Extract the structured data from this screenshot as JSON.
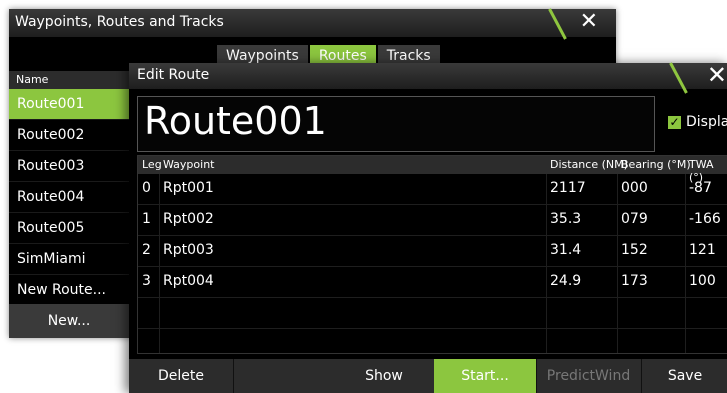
{
  "back_window": {
    "title": "Waypoints, Routes and Tracks",
    "tabs": [
      "Waypoints",
      "Routes",
      "Tracks"
    ],
    "list_header": "Name",
    "items": [
      "Route001",
      "Route002",
      "Route003",
      "Route004",
      "Route005",
      "SimMiami",
      "New Route..."
    ],
    "footer_button": "New...",
    "accent": "#8cc63f"
  },
  "front_window": {
    "title": "Edit Route",
    "route_name": "Route001",
    "display_label": "Display",
    "columns": {
      "leg": "Leg",
      "waypoint": "Waypoint",
      "distance": "Distance (NM)",
      "bearing": "Bearing (°M)",
      "twa": "TWA (°)"
    },
    "rows": [
      {
        "leg": "0",
        "waypoint": "Rpt001",
        "distance": "2117",
        "bearing": "000",
        "twa": "-87"
      },
      {
        "leg": "1",
        "waypoint": "Rpt002",
        "distance": "35.3",
        "bearing": "079",
        "twa": "-166"
      },
      {
        "leg": "2",
        "waypoint": "Rpt003",
        "distance": "31.4",
        "bearing": "152",
        "twa": "121"
      },
      {
        "leg": "3",
        "waypoint": "Rpt004",
        "distance": "24.9",
        "bearing": "173",
        "twa": "100"
      }
    ],
    "footer": {
      "delete": "Delete",
      "show": "Show",
      "start": "Start...",
      "predictwind": "PredictWind",
      "save": "Save"
    }
  }
}
